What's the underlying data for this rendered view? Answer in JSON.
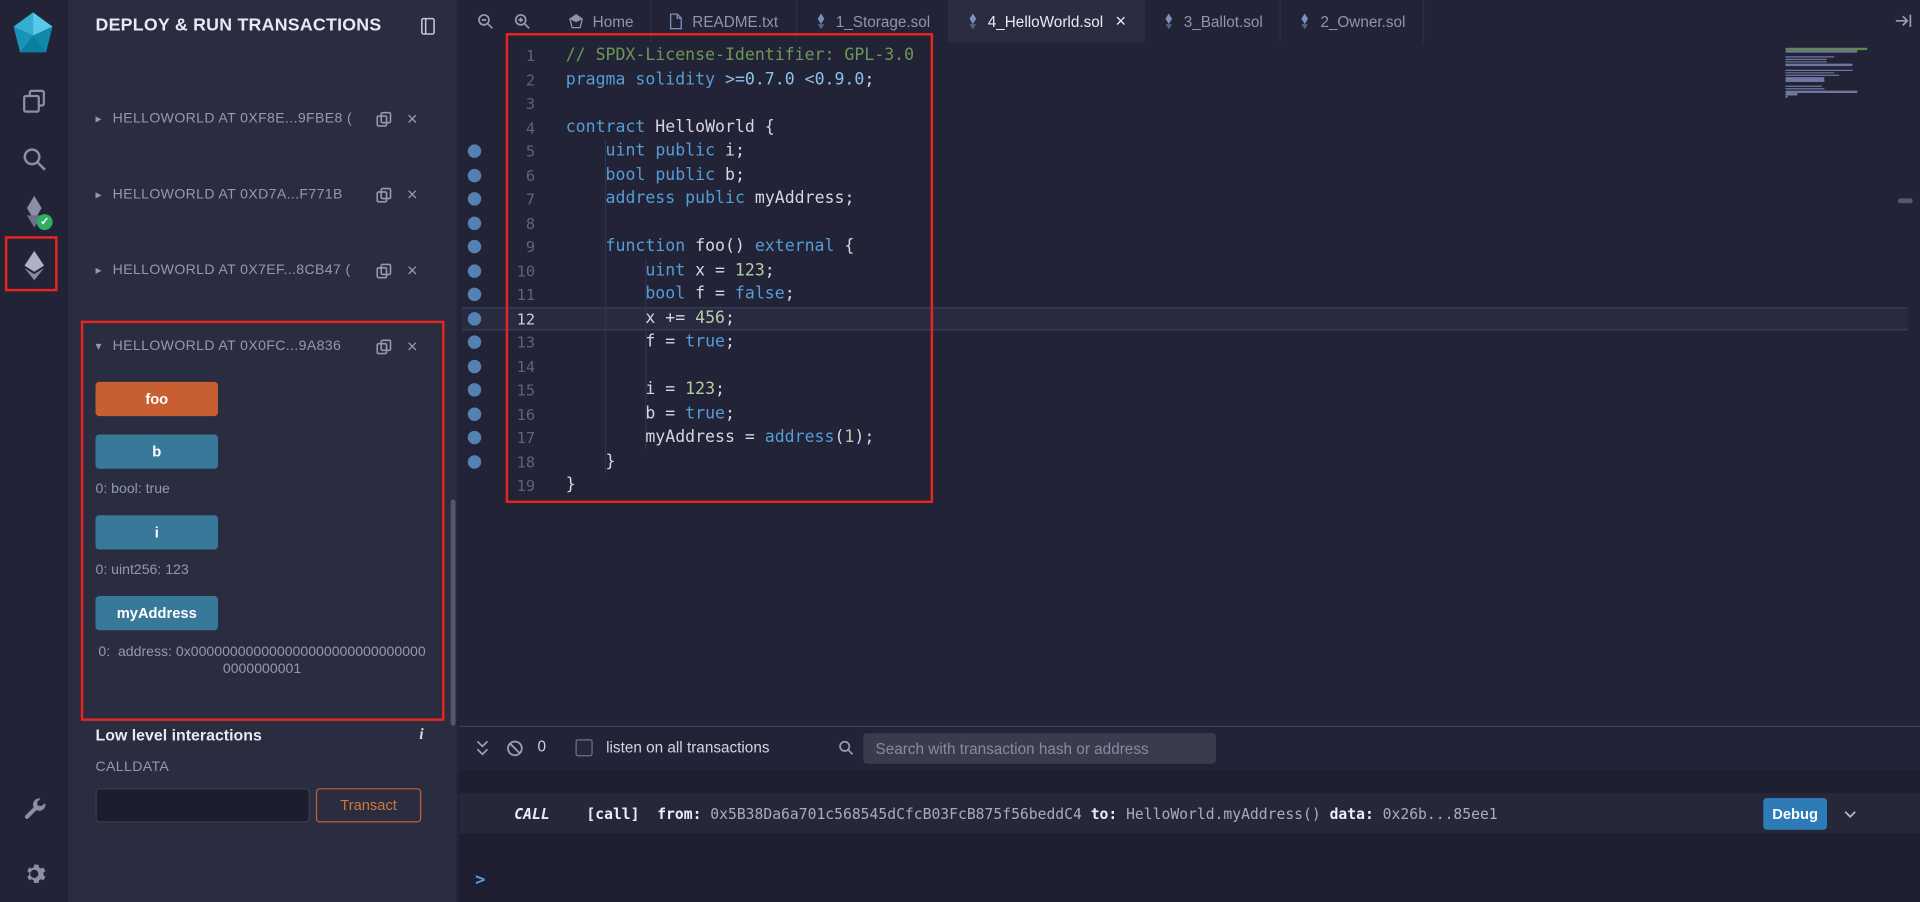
{
  "colors": {
    "annotation_red": "#e8251f",
    "call_button_blue": "#38799a",
    "fallback_button_orange": "#c75f33",
    "debug_button_blue": "#2e7cb7",
    "panel_background": "#2a2c3f",
    "editor_background": "#222336"
  },
  "side_panel": {
    "title": "DEPLOY & RUN TRANSACTIONS",
    "contracts": [
      {
        "label": "HELLOWORLD AT 0XF8E...9FBE8 (",
        "expanded": false
      },
      {
        "label": "HELLOWORLD AT 0XD7A...F771B",
        "expanded": false
      },
      {
        "label": "HELLOWORLD AT 0X7EF...8CB47 (",
        "expanded": false
      },
      {
        "label": "HELLOWORLD AT 0X0FC...9A836",
        "expanded": true,
        "items": [
          {
            "kind": "button",
            "variant": "orange",
            "label": "foo"
          },
          {
            "kind": "button",
            "variant": "blue",
            "label": "b"
          },
          {
            "kind": "output",
            "text": "0: bool: true"
          },
          {
            "kind": "button",
            "variant": "blue",
            "label": "i"
          },
          {
            "kind": "output",
            "text": "0: uint256: 123"
          },
          {
            "kind": "button",
            "variant": "blue",
            "label": "myAddress"
          },
          {
            "kind": "output-wrap",
            "text": "0:  address: 0x0000000000000000000000000000000000000001"
          }
        ]
      }
    ],
    "low_level": {
      "title": "Low level interactions",
      "calldata_label": "CALLDATA",
      "input_value": "",
      "transact_label": "Transact"
    }
  },
  "editor_tabs": [
    {
      "label": "Home",
      "icon": "home",
      "active": false,
      "close": false
    },
    {
      "label": "README.txt",
      "icon": "file",
      "active": false,
      "close": false
    },
    {
      "label": "1_Storage.sol",
      "icon": "solidity",
      "active": false,
      "close": false
    },
    {
      "label": "4_HelloWorld.sol",
      "icon": "solidity",
      "active": true,
      "close": true
    },
    {
      "label": "3_Ballot.sol",
      "icon": "solidity",
      "active": false,
      "close": false
    },
    {
      "label": "2_Owner.sol",
      "icon": "solidity",
      "active": false,
      "close": false
    }
  ],
  "editor": {
    "current_line": 12,
    "dot_lines": [
      5,
      6,
      7,
      8,
      9,
      10,
      11,
      12,
      13,
      14,
      15,
      16,
      17,
      18
    ],
    "lines": [
      {
        "n": 1,
        "tokens": [
          {
            "c": "com",
            "t": "// SPDX-License-Identifier: GPL-3.0"
          }
        ]
      },
      {
        "n": 2,
        "tokens": [
          {
            "c": "kw",
            "t": "pragma"
          },
          {
            "c": "pl",
            "t": " "
          },
          {
            "c": "kw",
            "t": "solidity"
          },
          {
            "c": "ver",
            "t": " >=0.7.0 <0.9.0"
          },
          {
            "c": "pl",
            "t": ";"
          }
        ]
      },
      {
        "n": 3,
        "tokens": []
      },
      {
        "n": 4,
        "tokens": [
          {
            "c": "kw",
            "t": "contract"
          },
          {
            "c": "pl",
            "t": " HelloWorld {"
          }
        ]
      },
      {
        "n": 5,
        "tokens": [
          {
            "c": "pl",
            "t": "    "
          },
          {
            "c": "kw",
            "t": "uint"
          },
          {
            "c": "pl",
            "t": " "
          },
          {
            "c": "kw",
            "t": "public"
          },
          {
            "c": "pl",
            "t": " i;"
          }
        ]
      },
      {
        "n": 6,
        "tokens": [
          {
            "c": "pl",
            "t": "    "
          },
          {
            "c": "kw",
            "t": "bool"
          },
          {
            "c": "pl",
            "t": " "
          },
          {
            "c": "kw",
            "t": "public"
          },
          {
            "c": "pl",
            "t": " b;"
          }
        ]
      },
      {
        "n": 7,
        "tokens": [
          {
            "c": "pl",
            "t": "    "
          },
          {
            "c": "kw",
            "t": "address"
          },
          {
            "c": "pl",
            "t": " "
          },
          {
            "c": "kw",
            "t": "public"
          },
          {
            "c": "pl",
            "t": " myAddress;"
          }
        ]
      },
      {
        "n": 8,
        "tokens": []
      },
      {
        "n": 9,
        "tokens": [
          {
            "c": "pl",
            "t": "    "
          },
          {
            "c": "kw",
            "t": "function"
          },
          {
            "c": "pl",
            "t": " foo() "
          },
          {
            "c": "kw",
            "t": "external"
          },
          {
            "c": "pl",
            "t": " {"
          }
        ]
      },
      {
        "n": 10,
        "tokens": [
          {
            "c": "pl",
            "t": "        "
          },
          {
            "c": "kw",
            "t": "uint"
          },
          {
            "c": "pl",
            "t": " x = "
          },
          {
            "c": "num",
            "t": "123"
          },
          {
            "c": "pl",
            "t": ";"
          }
        ]
      },
      {
        "n": 11,
        "tokens": [
          {
            "c": "pl",
            "t": "        "
          },
          {
            "c": "kw",
            "t": "bool"
          },
          {
            "c": "pl",
            "t": " f = "
          },
          {
            "c": "kw",
            "t": "false"
          },
          {
            "c": "pl",
            "t": ";"
          }
        ]
      },
      {
        "n": 12,
        "tokens": [
          {
            "c": "pl",
            "t": "        x += "
          },
          {
            "c": "num",
            "t": "456"
          },
          {
            "c": "pl",
            "t": ";"
          }
        ]
      },
      {
        "n": 13,
        "tokens": [
          {
            "c": "pl",
            "t": "        f = "
          },
          {
            "c": "kw",
            "t": "true"
          },
          {
            "c": "pl",
            "t": ";"
          }
        ]
      },
      {
        "n": 14,
        "tokens": []
      },
      {
        "n": 15,
        "tokens": [
          {
            "c": "pl",
            "t": "        i = "
          },
          {
            "c": "num",
            "t": "123"
          },
          {
            "c": "pl",
            "t": ";"
          }
        ]
      },
      {
        "n": 16,
        "tokens": [
          {
            "c": "pl",
            "t": "        b = "
          },
          {
            "c": "kw",
            "t": "true"
          },
          {
            "c": "pl",
            "t": ";"
          }
        ]
      },
      {
        "n": 17,
        "tokens": [
          {
            "c": "pl",
            "t": "        myAddress = "
          },
          {
            "c": "kw",
            "t": "address"
          },
          {
            "c": "pl",
            "t": "("
          },
          {
            "c": "num",
            "t": "1"
          },
          {
            "c": "pl",
            "t": ");"
          }
        ]
      },
      {
        "n": 18,
        "tokens": [
          {
            "c": "pl",
            "t": "    }"
          }
        ]
      },
      {
        "n": 19,
        "tokens": [
          {
            "c": "pl",
            "t": "}"
          }
        ]
      }
    ]
  },
  "terminal": {
    "badge_count": "0",
    "listen_label": "listen on all transactions",
    "listen_checked": false,
    "search_placeholder": "Search with transaction hash or address",
    "prompt": ">",
    "log": {
      "badge": "CALL",
      "debug_label": "Debug",
      "segments": [
        {
          "style": "bold",
          "text": "[call]"
        },
        {
          "style": "label",
          "text": "  from: "
        },
        {
          "style": "value",
          "text": "0x5B38Da6a701c568545dCfcB03FcB875f56beddC4"
        },
        {
          "style": "label",
          "text": " to: "
        },
        {
          "style": "value",
          "text": "HelloWorld.myAddress()"
        },
        {
          "style": "label",
          "text": " data: "
        },
        {
          "style": "value",
          "text": "0x26b...85ee1"
        }
      ]
    }
  }
}
